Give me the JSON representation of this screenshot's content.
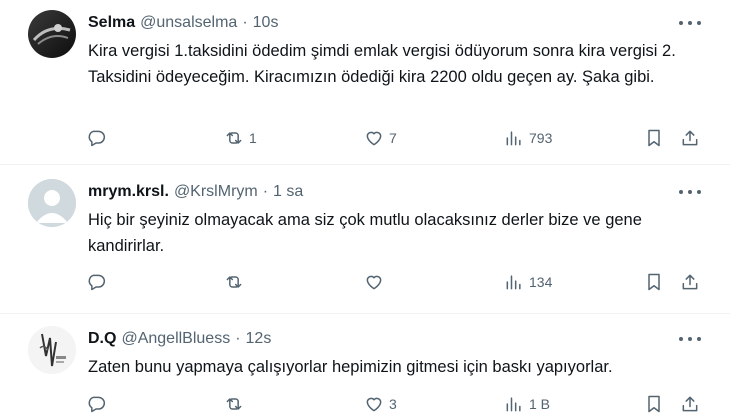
{
  "tweets": [
    {
      "name": "Selma",
      "handle": "@unsalselma",
      "sep": "·",
      "time": "10s",
      "text": "Kira vergisi 1.taksidini ödedim şimdi emlak vergisi ödüyorum sonra kira vergisi 2. Taksidini ödeyeceğim. Kiracımızın ödediği kira 2200 oldu geçen ay. Şaka gibi.",
      "replies": "",
      "retweets": "1",
      "likes": "7",
      "views": "793"
    },
    {
      "name": "mrym.krsl.",
      "handle": "@KrslMrym",
      "sep": "·",
      "time": "1 sa",
      "text": "Hiç bir şeyiniz olmayacak ama siz çok  mutlu olacaksınız derler bize ve gene kandirirlar.",
      "replies": "",
      "retweets": "",
      "likes": "",
      "views": "134"
    },
    {
      "name": "D.Q",
      "handle": "@AngellBluess",
      "sep": "·",
      "time": "12s",
      "text": "Zaten bunu yapmaya çalışıyorlar hepimizin gitmesi için baskı yapıyorlar.",
      "replies": "",
      "retweets": "",
      "likes": "3",
      "views": "1 B"
    }
  ],
  "colors": {
    "text": "#0f1419",
    "secondary": "#536471",
    "divider": "#eff3f4"
  },
  "icons": [
    "reply-icon",
    "retweet-icon",
    "like-icon",
    "views-icon",
    "bookmark-icon",
    "share-icon",
    "more-icon"
  ]
}
